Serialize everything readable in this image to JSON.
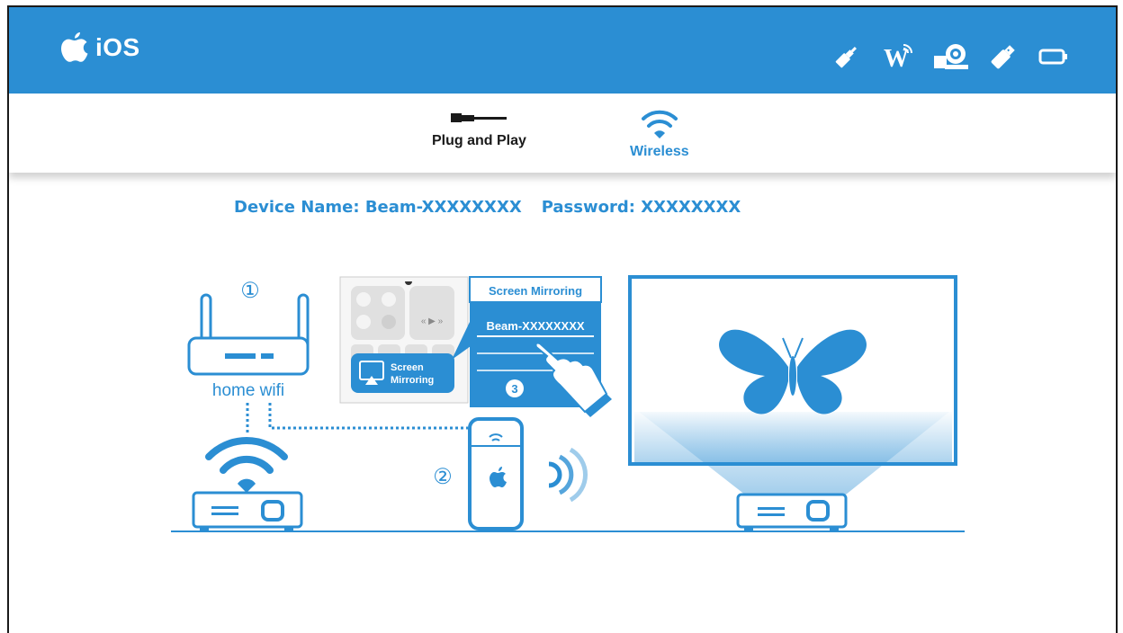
{
  "header": {
    "brand_label": "iOS",
    "icons": [
      "hdmi-plug-icon",
      "wifi-w-icon",
      "webcam-icon",
      "usb-drive-icon",
      "battery-icon"
    ],
    "bg_color": "#2b8ed3"
  },
  "tabs": [
    {
      "label": "Plug and Play",
      "icon": "hdmi-cable-icon",
      "active": false
    },
    {
      "label": "Wireless",
      "icon": "wifi-icon",
      "active": true
    }
  ],
  "info": {
    "device_name": "Device Name: Beam-XXXXXXXX",
    "password": "Password: XXXXXXXX"
  },
  "diagram": {
    "router_label": "home wifi",
    "step1": "①",
    "step2": "②",
    "step3": "3",
    "panel_title": "Screen Mirroring",
    "panel_device": "Beam-XXXXXXXX",
    "control_center_button_line1": "Screen",
    "control_center_button_line2": "Mirroring",
    "accent_color": "#2b8ed3"
  }
}
